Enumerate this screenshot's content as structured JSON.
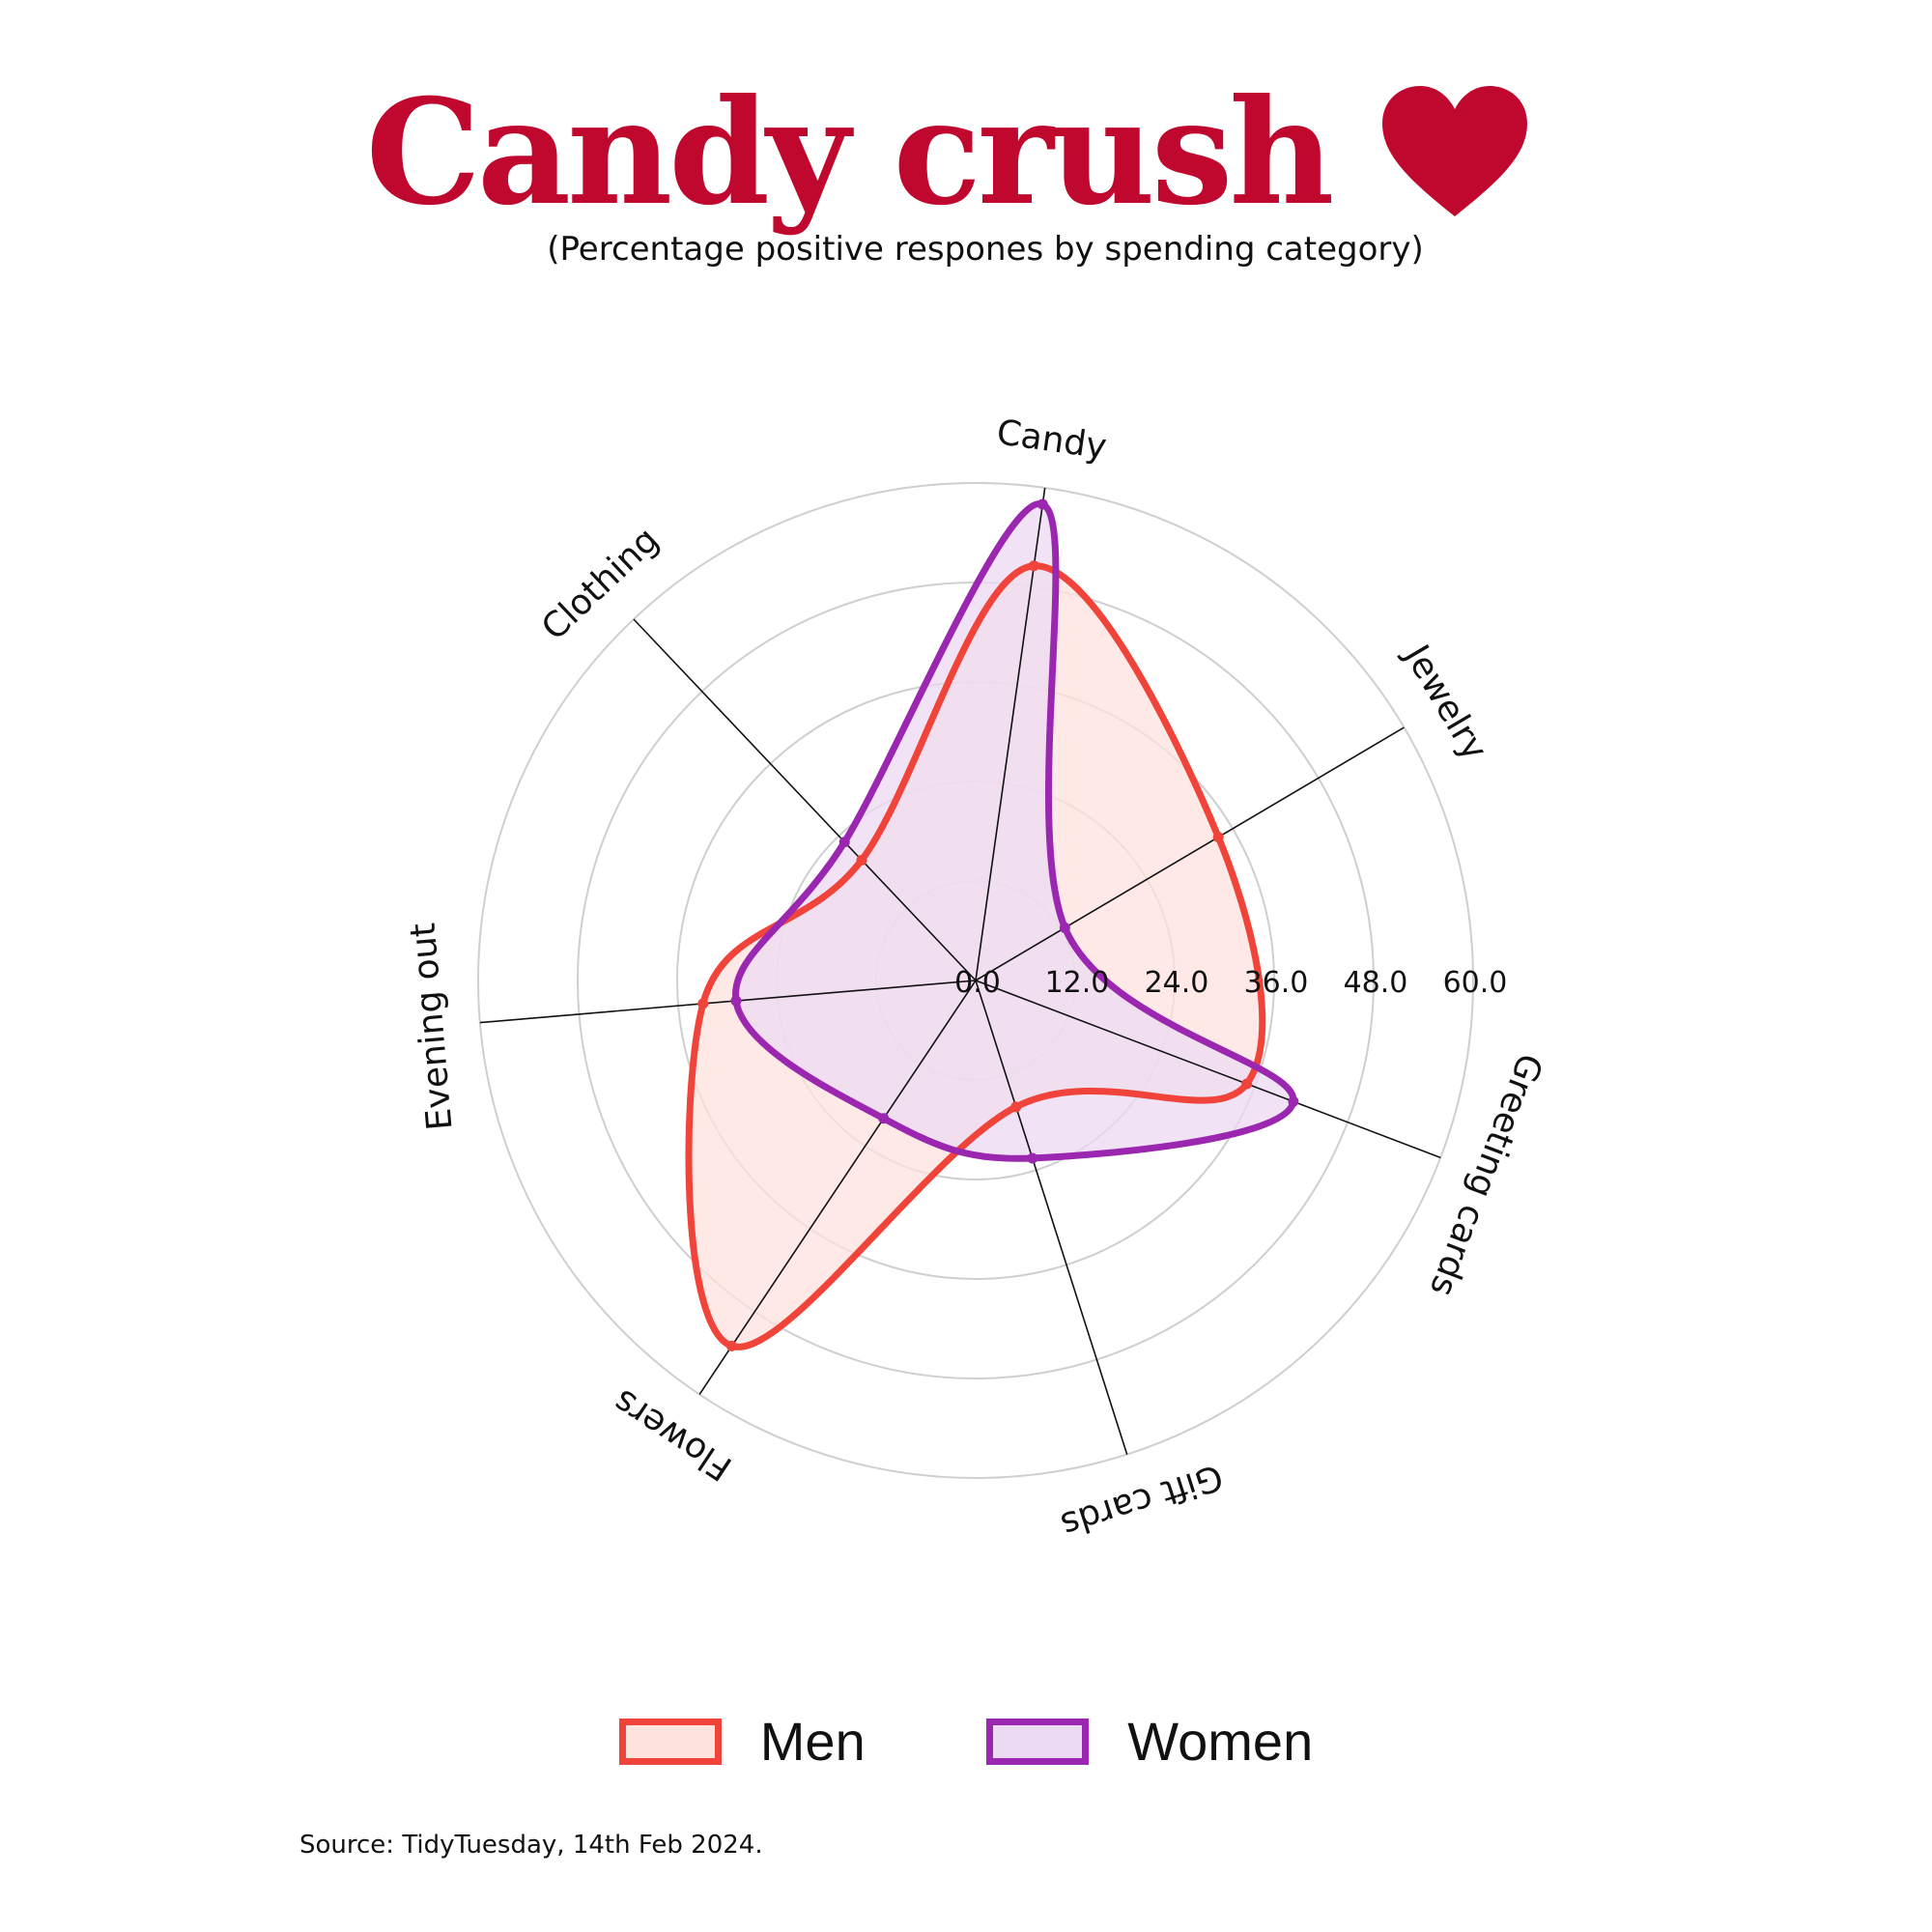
{
  "title": "Candy crush",
  "subtitle": "(Percentage positive respones by spending category)",
  "source": "Source: TidyTuesday, 14th Feb 2024.",
  "chart_data": {
    "type": "radar",
    "categories": [
      "Candy",
      "Jewelry",
      "Greeting cards",
      "Gift cards",
      "Flowers",
      "Evening out",
      "Clothing"
    ],
    "r_ticks": [
      "0.0",
      "12.0",
      "24.0",
      "36.0",
      "48.0",
      "60.0"
    ],
    "rlim": [
      0,
      60
    ],
    "grid": true,
    "legend_position": "bottom",
    "series": [
      {
        "name": "Men",
        "values": [
          50.5,
          34.0,
          35.0,
          16.0,
          53.0,
          33.0,
          20.0
        ],
        "color": "#f0443a",
        "fill": "#fde2de"
      },
      {
        "name": "Women",
        "values": [
          58.0,
          12.5,
          41.0,
          22.5,
          20.0,
          29.0,
          23.0
        ],
        "color": "#9b27b0",
        "fill": "#ecdaf2"
      }
    ]
  }
}
